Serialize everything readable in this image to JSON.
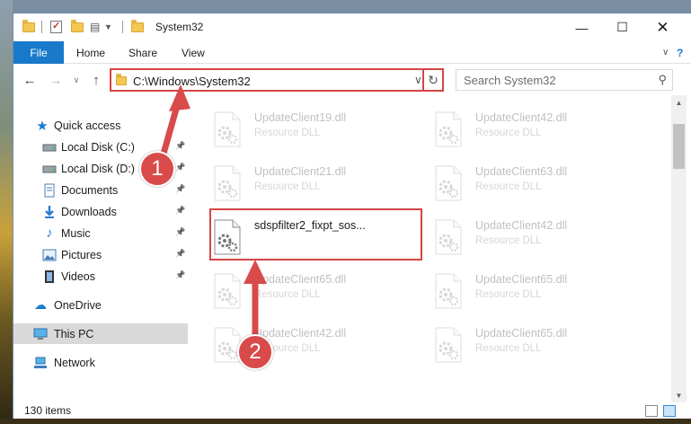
{
  "window": {
    "title": "System32"
  },
  "ribbon": {
    "file": "File",
    "tabs": [
      "Home",
      "Share",
      "View"
    ]
  },
  "address": {
    "path": "C:\\Windows\\System32",
    "search_placeholder": "Search System32"
  },
  "nav": {
    "quick_access": "Quick access",
    "items": [
      {
        "label": "Local Disk (C:)",
        "icon": "drive-icon",
        "pinned": true
      },
      {
        "label": "Local Disk (D:)",
        "icon": "drive-icon",
        "pinned": true
      },
      {
        "label": "Documents",
        "icon": "documents-icon",
        "pinned": true
      },
      {
        "label": "Downloads",
        "icon": "downloads-icon",
        "pinned": true
      },
      {
        "label": "Music",
        "icon": "music-icon",
        "pinned": true
      },
      {
        "label": "Pictures",
        "icon": "pictures-icon",
        "pinned": true
      },
      {
        "label": "Videos",
        "icon": "videos-icon",
        "pinned": true
      }
    ],
    "onedrive": "OneDrive",
    "this_pc": "This PC",
    "network": "Network"
  },
  "files": {
    "left": [
      {
        "name": "UpdateClient19.dll",
        "type": "Resource DLL"
      },
      {
        "name": "UpdateClient21.dll",
        "type": "Resource DLL"
      },
      {
        "name": "sdspfilter2_fixpt_sos...",
        "type": ""
      },
      {
        "name": "UpdateClient65.dll",
        "type": "Resource DLL"
      },
      {
        "name": "UpdateClient42.dll",
        "type": "Resource DLL"
      }
    ],
    "right": [
      {
        "name": "UpdateClient42.dll",
        "type": "Resource DLL"
      },
      {
        "name": "UpdateClient63.dll",
        "type": "Resource DLL"
      },
      {
        "name": "UpdateClient42.dll",
        "type": "Resource DLL"
      },
      {
        "name": "UpdateClient65.dll",
        "type": "Resource DLL"
      },
      {
        "name": "UpdateClient65.dll",
        "type": "Resource DLL"
      }
    ]
  },
  "status": {
    "item_count": "130 items"
  },
  "callouts": {
    "one": "1",
    "two": "2"
  },
  "colors": {
    "accent": "#1979ca",
    "highlight_red": "#d64545",
    "selected_bg": "#d9d9d9"
  }
}
